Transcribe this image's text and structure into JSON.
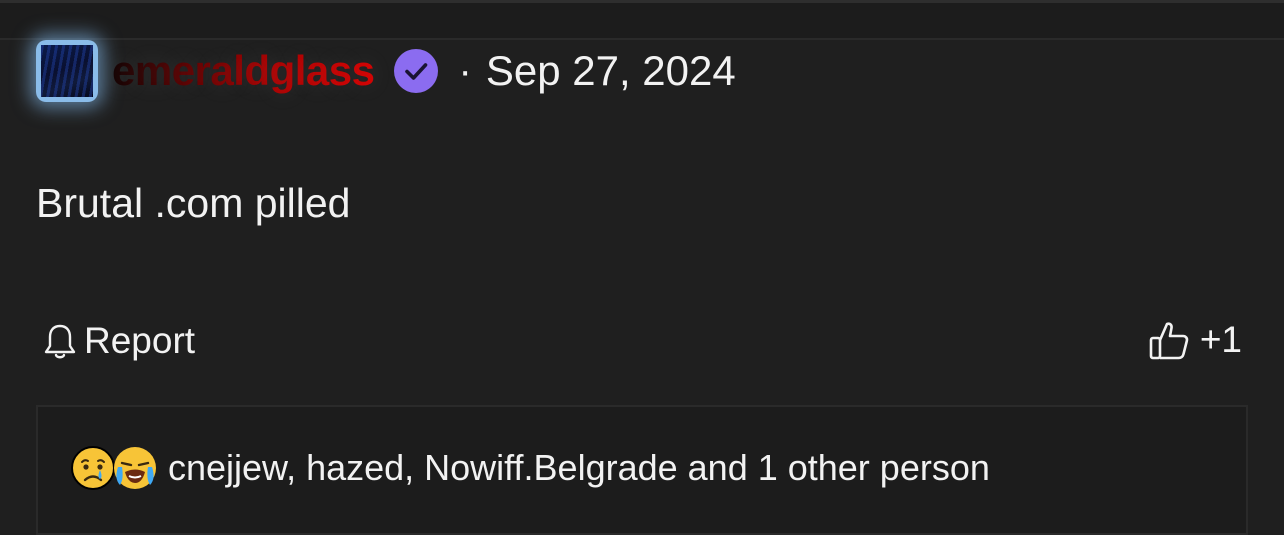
{
  "post": {
    "author": "emeraldglass",
    "separator": "·",
    "date": "Sep 27, 2024",
    "content": "Brutal .com pilled",
    "avatar_icon": "avatar-image",
    "verified_icon": "verified-badge-icon",
    "verified_color": "#8b6cf0",
    "username_gradient": [
      "#120000",
      "#5a0000",
      "#a80000",
      "#d40000"
    ]
  },
  "actions": {
    "report_label": "Report",
    "report_icon": "bell-icon",
    "like_icon": "thumbs-up-icon",
    "like_count": "+1"
  },
  "reactions": {
    "emojis": [
      "crying-face-emoji",
      "loudly-crying-face-emoji"
    ],
    "summary": "cnejjew, hazed, Nowiff.Belgrade and 1 other person"
  },
  "colors": {
    "background": "#1f1f1f",
    "text": "#f2f2f2",
    "reactions_panel": "#1c1c1c"
  }
}
